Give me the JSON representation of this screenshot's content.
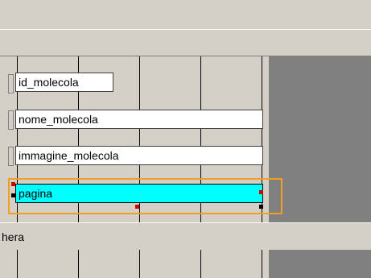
{
  "fields": [
    {
      "label": "id_molecola"
    },
    {
      "label": "nome_molecola"
    },
    {
      "label": "immagine_molecola"
    },
    {
      "label": "pagina"
    }
  ],
  "footer": {
    "label": "hera"
  },
  "colors": {
    "selected_field_bg": "#00ffff",
    "selection_frame": "#f0a020",
    "dark_pane": "#808080",
    "dialog_bg": "#d4d0c8"
  }
}
